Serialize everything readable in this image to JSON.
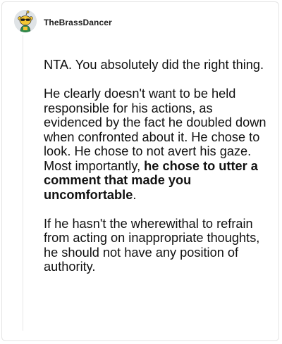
{
  "comment": {
    "username": "TheBrassDancer",
    "avatar_icon": "snoo-avatar-sunglasses-icon",
    "paragraph1": "NTA. You absolutely did the right thing.",
    "paragraph2_a": "He clearly doesn't want to be held responsible for his actions, as evidenced by the fact he doubled down when confronted about it. He chose to look. He chose to not avert his gaze. Most importantly, ",
    "paragraph2_bold": "he chose to utter a comment that made you uncomfortable",
    "paragraph2_end": ".",
    "paragraph3": "If he hasn't the wherewithal to refrain from acting on inappropriate thoughts, he should not have any position of authority."
  },
  "colors": {
    "background": "#ffffff",
    "border": "#e4e4e4",
    "text": "#111111",
    "avatar_bg": "#dfe3e6",
    "avatar_body": "#f4c531"
  }
}
